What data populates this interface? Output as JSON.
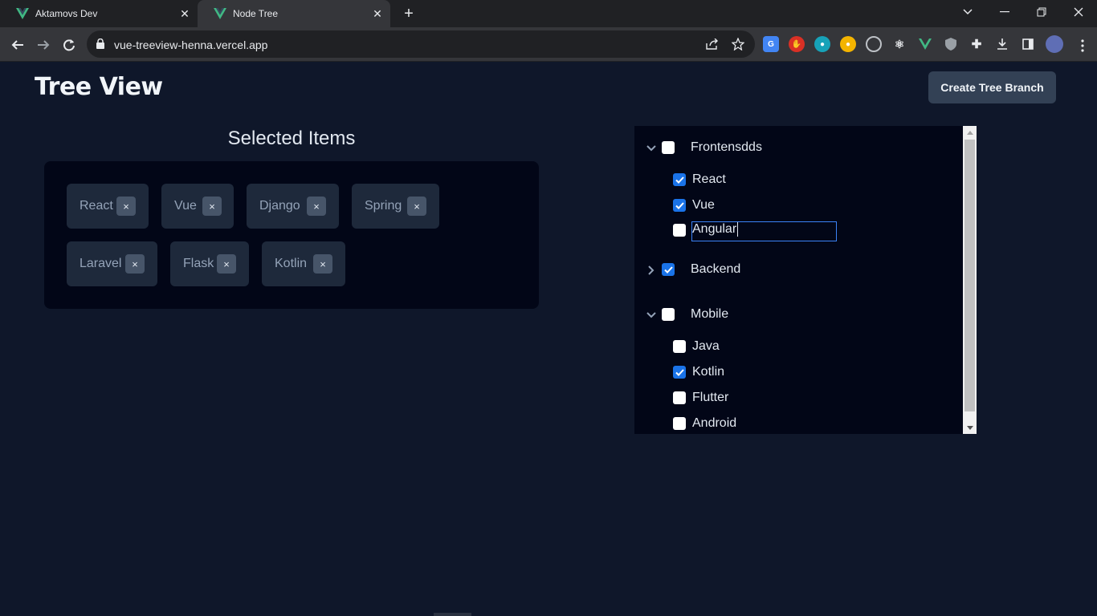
{
  "browser": {
    "tabs": [
      {
        "title": "Aktamovs Dev",
        "active": false
      },
      {
        "title": "Node Tree",
        "active": true
      }
    ],
    "url": "vue-treeview-henna.vercel.app",
    "accent": "#41b883"
  },
  "page": {
    "title": "Tree View",
    "create_button": "Create Tree Branch",
    "selected_title": "Selected Items",
    "selected_items": [
      "React",
      "Vue",
      "Django",
      "Spring",
      "Laravel",
      "Flask",
      "Kotlin"
    ],
    "chip_close": "×"
  },
  "tree": {
    "groups": [
      {
        "label": "Frontensdds",
        "expanded": true,
        "checked": false,
        "children": [
          {
            "label": "React",
            "checked": true
          },
          {
            "label": "Vue",
            "checked": true
          }
        ],
        "editing_value": "Angular"
      },
      {
        "label": "Backend",
        "expanded": false,
        "checked": true,
        "children": []
      },
      {
        "label": "Mobile",
        "expanded": true,
        "checked": false,
        "children": [
          {
            "label": "Java",
            "checked": false
          },
          {
            "label": "Kotlin",
            "checked": true
          },
          {
            "label": "Flutter",
            "checked": false
          },
          {
            "label": "Android",
            "checked": false
          }
        ]
      }
    ]
  },
  "colors": {
    "page_bg": "#0f172a",
    "panel_bg": "#020617",
    "chip_bg": "#1e293b",
    "button_bg": "#334155",
    "checkbox_checked": "#1a73e8"
  }
}
